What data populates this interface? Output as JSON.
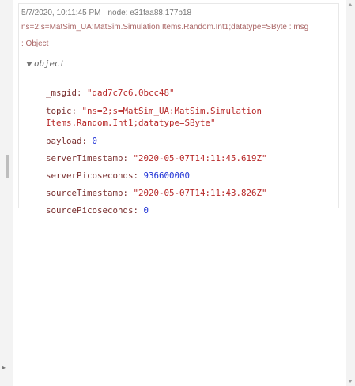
{
  "debug_message": {
    "timestamp": "5/7/2020, 10:11:45 PM",
    "node": "node: e31faa88.177b18",
    "topic_line": "ns=2;s=MatSim_UA:MatSim.Simulation Items.Random.Int1;datatype=SByte : msg",
    "type_line": ": Object",
    "object_label": "object",
    "fields": [
      {
        "key": "_msgid",
        "value": "\"dad7c7c6.0bcc48\"",
        "kind": "string"
      },
      {
        "key": "topic",
        "value": "\"ns=2;s=MatSim_UA:MatSim.Simulation",
        "kind": "string",
        "continuation": "Items.Random.Int1;datatype=SByte\""
      },
      {
        "key": "payload",
        "value": "0",
        "kind": "number"
      },
      {
        "key": "serverTimestamp",
        "value": "\"2020-05-07T14:11:45.619Z\"",
        "kind": "string"
      },
      {
        "key": "serverPicoseconds",
        "value": "936600000",
        "kind": "number"
      },
      {
        "key": "sourceTimestamp",
        "value": "\"2020-05-07T14:11:43.826Z\"",
        "kind": "string"
      },
      {
        "key": "sourcePicoseconds",
        "value": "0",
        "kind": "number"
      }
    ]
  }
}
